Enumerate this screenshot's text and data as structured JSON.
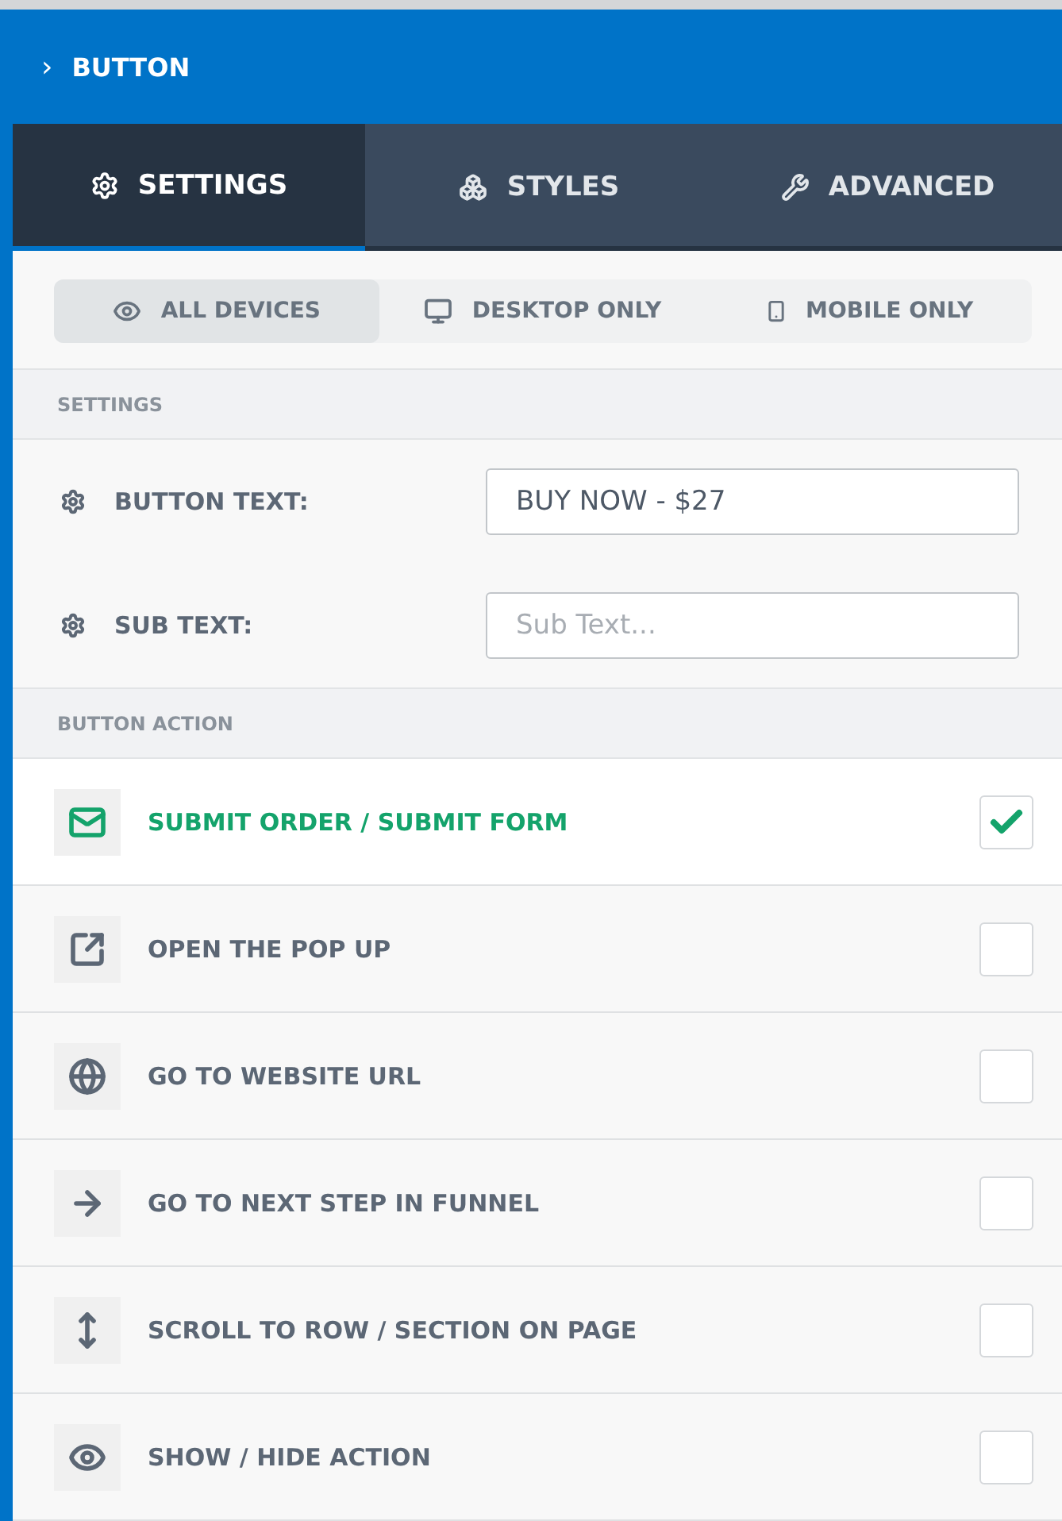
{
  "header": {
    "caret": "›",
    "title": "BUTTON"
  },
  "tabs": [
    {
      "label": "SETTINGS",
      "selected": true
    },
    {
      "label": "STYLES",
      "selected": false
    },
    {
      "label": "ADVANCED",
      "selected": false
    }
  ],
  "devices": [
    {
      "label": "ALL DEVICES",
      "selected": true
    },
    {
      "label": "DESKTOP ONLY",
      "selected": false
    },
    {
      "label": "MOBILE ONLY",
      "selected": false
    }
  ],
  "settings": {
    "heading": "SETTINGS",
    "fields": [
      {
        "label": "BUTTON TEXT:",
        "value": "BUY NOW - $27"
      },
      {
        "label": "SUB TEXT:",
        "placeholder": "Sub Text..."
      }
    ]
  },
  "button_action": {
    "heading": "BUTTON ACTION",
    "actions": [
      {
        "label": "SUBMIT ORDER / SUBMIT FORM",
        "checked": true
      },
      {
        "label": "OPEN THE POP UP",
        "checked": false
      },
      {
        "label": "GO TO WEBSITE URL",
        "checked": false
      },
      {
        "label": "GO TO NEXT STEP IN FUNNEL",
        "checked": false
      },
      {
        "label": "SCROLL TO ROW / SECTION ON PAGE",
        "checked": false
      },
      {
        "label": "SHOW / HIDE ACTION",
        "checked": false
      }
    ]
  }
}
